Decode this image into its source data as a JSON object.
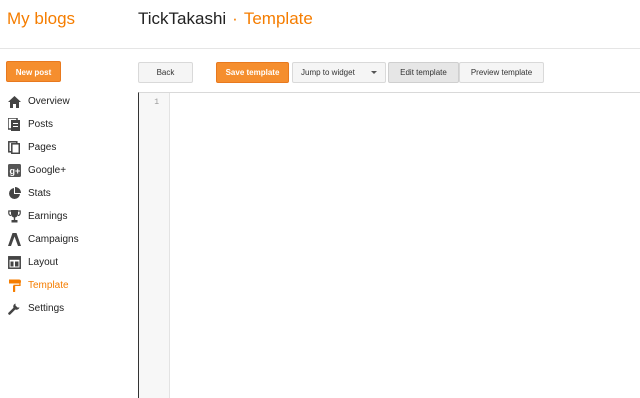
{
  "header": {
    "my_blogs": "My blogs",
    "blog_name": "TickTakashi",
    "separator": "·",
    "page_title": "Template"
  },
  "sidebar": {
    "new_post": "New post",
    "items": [
      {
        "label": "Overview",
        "icon": "home-icon"
      },
      {
        "label": "Posts",
        "icon": "posts-icon"
      },
      {
        "label": "Pages",
        "icon": "pages-icon"
      },
      {
        "label": "Google+",
        "icon": "google-plus-icon"
      },
      {
        "label": "Stats",
        "icon": "pie-chart-icon"
      },
      {
        "label": "Earnings",
        "icon": "trophy-icon"
      },
      {
        "label": "Campaigns",
        "icon": "campaigns-icon"
      },
      {
        "label": "Layout",
        "icon": "layout-icon"
      },
      {
        "label": "Template",
        "icon": "template-icon",
        "active": true
      },
      {
        "label": "Settings",
        "icon": "wrench-icon"
      }
    ]
  },
  "toolbar": {
    "back": "Back",
    "save": "Save template",
    "jump": "Jump to widget",
    "edit": "Edit template",
    "preview": "Preview template"
  },
  "editor": {
    "line_number": "1"
  },
  "colors": {
    "accent": "#f57d00",
    "button_orange": "#f58e2e"
  }
}
